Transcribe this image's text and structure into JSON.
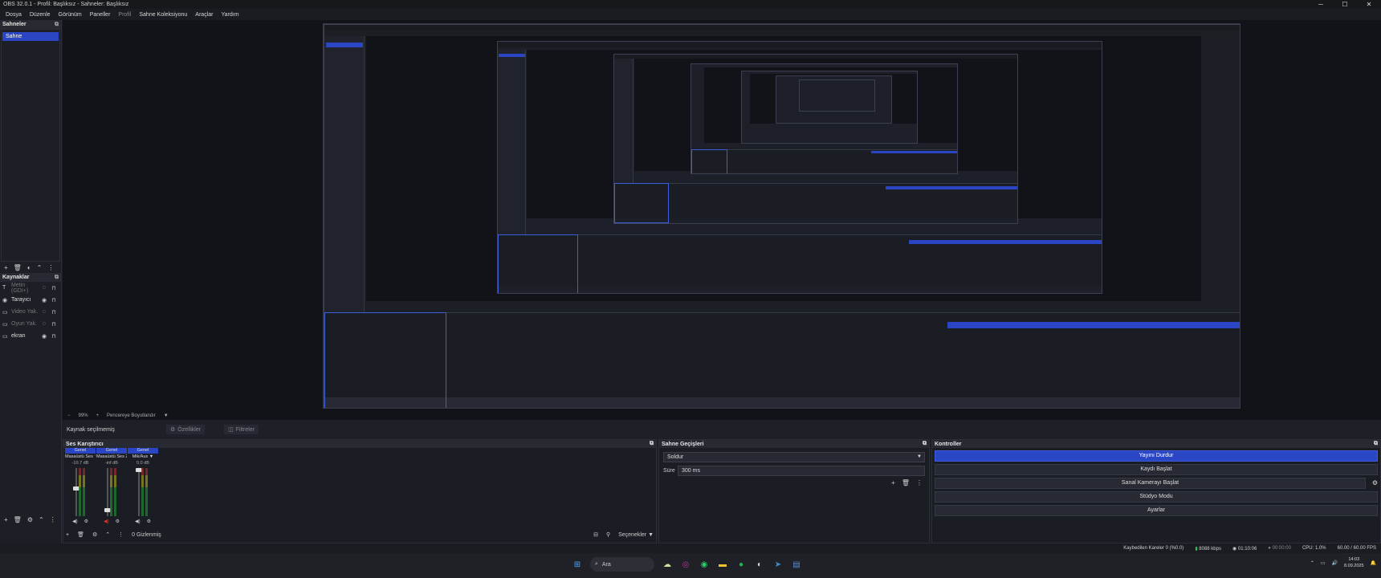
{
  "window": {
    "title": "OBS 32.0.1 - Profil: Başlıksız - Sahneler: Başlıksız",
    "minimize": "─",
    "maximize": "☐",
    "close": "✕"
  },
  "menu": [
    "Dosya",
    "Düzenle",
    "Görünüm",
    "Paneller",
    "Profil",
    "Sahne Koleksiyonu",
    "Araçlar",
    "Yardım"
  ],
  "scenes": {
    "title": "Sahneler",
    "items": [
      "Sahne"
    ]
  },
  "sources": {
    "title": "Kaynaklar",
    "items": [
      {
        "name": "Metin (GDI+)",
        "icon": "text-icon",
        "glyph": "T",
        "hidden": true
      },
      {
        "name": "Tarayıcı",
        "icon": "browser-icon",
        "glyph": "◉",
        "hidden": false
      },
      {
        "name": "Video Yak.",
        "icon": "video-capture-icon",
        "glyph": "▭",
        "hidden": true
      },
      {
        "name": "Oyun Yak.",
        "icon": "game-capture-icon",
        "glyph": "▭",
        "hidden": true
      },
      {
        "name": "ekran",
        "icon": "display-capture-icon",
        "glyph": "▭",
        "hidden": false
      }
    ]
  },
  "preview_toolbar": {
    "zoom": "99%",
    "mode": "Pencereye Boyutlandır"
  },
  "source_bar": {
    "label": "Kaynak seçilmemiş",
    "properties": "Özellikler",
    "filters": "Filtreler"
  },
  "mixer": {
    "title": "Ses Karıştırıcı",
    "channels": [
      {
        "type": "Genel",
        "name": "Masaüstü Ses",
        "db": "-10.7 dB",
        "knob_level": 0.58
      },
      {
        "type": "Genel",
        "name": "Masaüstü Ses 2",
        "db": "-inf dB",
        "knob_level": 0.1
      },
      {
        "type": "Genel",
        "name": "Mik/Aux",
        "db": "0.0 dB",
        "knob_level": 1.0
      }
    ],
    "footer_label": "Gizlenmiş",
    "options_label": "Seçenekler"
  },
  "transitions": {
    "title": "Sahne Geçişleri",
    "selected": "Soldur",
    "duration_label": "Süre",
    "duration_value": "300 ms"
  },
  "controls": {
    "title": "Kontroller",
    "buttons": [
      "Yayını Durdur",
      "Kaydı Başlat",
      "Sanal Kamerayı Başlat",
      "Stüdyo Modu",
      "Ayarlar"
    ]
  },
  "status": {
    "dropped": "Kaybedilen Kareler 0 (%0.0)",
    "bitrate": "8088 kbps",
    "stream_time": "01:10:06",
    "rec_time": "00:00:00",
    "cpu": "CPU: 1.0%",
    "fps": "60.00 / 60.00 FPS"
  },
  "taskbar": {
    "search_placeholder": "Ara",
    "time": "14:03",
    "date": "8.09.2025"
  },
  "colors": {
    "accent": "#2a46c4",
    "background": "#1d1f26",
    "stream_indicator": "#2fbf4a"
  }
}
